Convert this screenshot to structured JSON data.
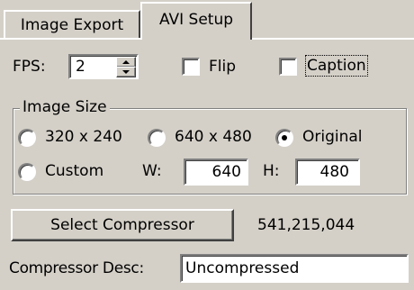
{
  "tabs": [
    {
      "label": "Image Export",
      "active": false
    },
    {
      "label": "AVI Setup",
      "active": true
    }
  ],
  "fps": {
    "label": "FPS:",
    "value": "2"
  },
  "flip": {
    "label": "Flip",
    "checked": false
  },
  "caption": {
    "label": "Caption",
    "checked": false
  },
  "image_size": {
    "legend": "Image Size",
    "options": [
      {
        "label": "320 x 240",
        "selected": false
      },
      {
        "label": "640 x 480",
        "selected": false
      },
      {
        "label": "Original",
        "selected": true
      },
      {
        "label": "Custom",
        "selected": false
      }
    ],
    "width_label": "W:",
    "width_value": "640",
    "height_label": "H:",
    "height_value": "480"
  },
  "compressor": {
    "button_label": "Select Compressor",
    "size_value": "541,215,044",
    "desc_label": "Compressor Desc:",
    "desc_value": "Uncompressed"
  },
  "colors": {
    "face": "#d4d0c8",
    "highlight": "#ffffff",
    "shadow": "#808080",
    "dark_shadow": "#404040"
  }
}
